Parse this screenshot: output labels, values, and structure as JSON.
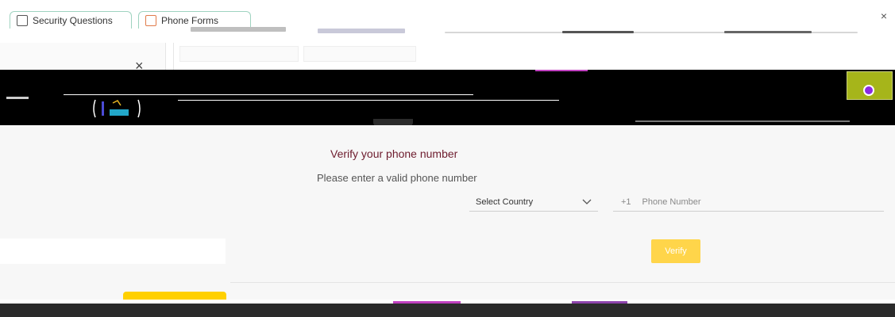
{
  "browser": {
    "tabs": [
      {
        "label": "Security Questions"
      },
      {
        "label": "Phone Forms"
      }
    ],
    "close_glyph": "×"
  },
  "panel": {
    "close_glyph": "×"
  },
  "verify": {
    "title": "Verify your phone number",
    "hint": "Please enter a valid phone number",
    "country_label": "Select Country",
    "country_code": "+1",
    "phone_placeholder": "Phone Number",
    "button_label": "Verify"
  },
  "colors": {
    "title": "#6e1c2e",
    "button_bg": "#ffd54a",
    "avatar_bg": "#a6b51a",
    "accent_tab": "#ffd000"
  },
  "icons": {
    "tab_1": "page-icon",
    "tab_2": "document-icon",
    "country_chevron": "chevron-down-icon",
    "avatar": "avatar-icon"
  }
}
